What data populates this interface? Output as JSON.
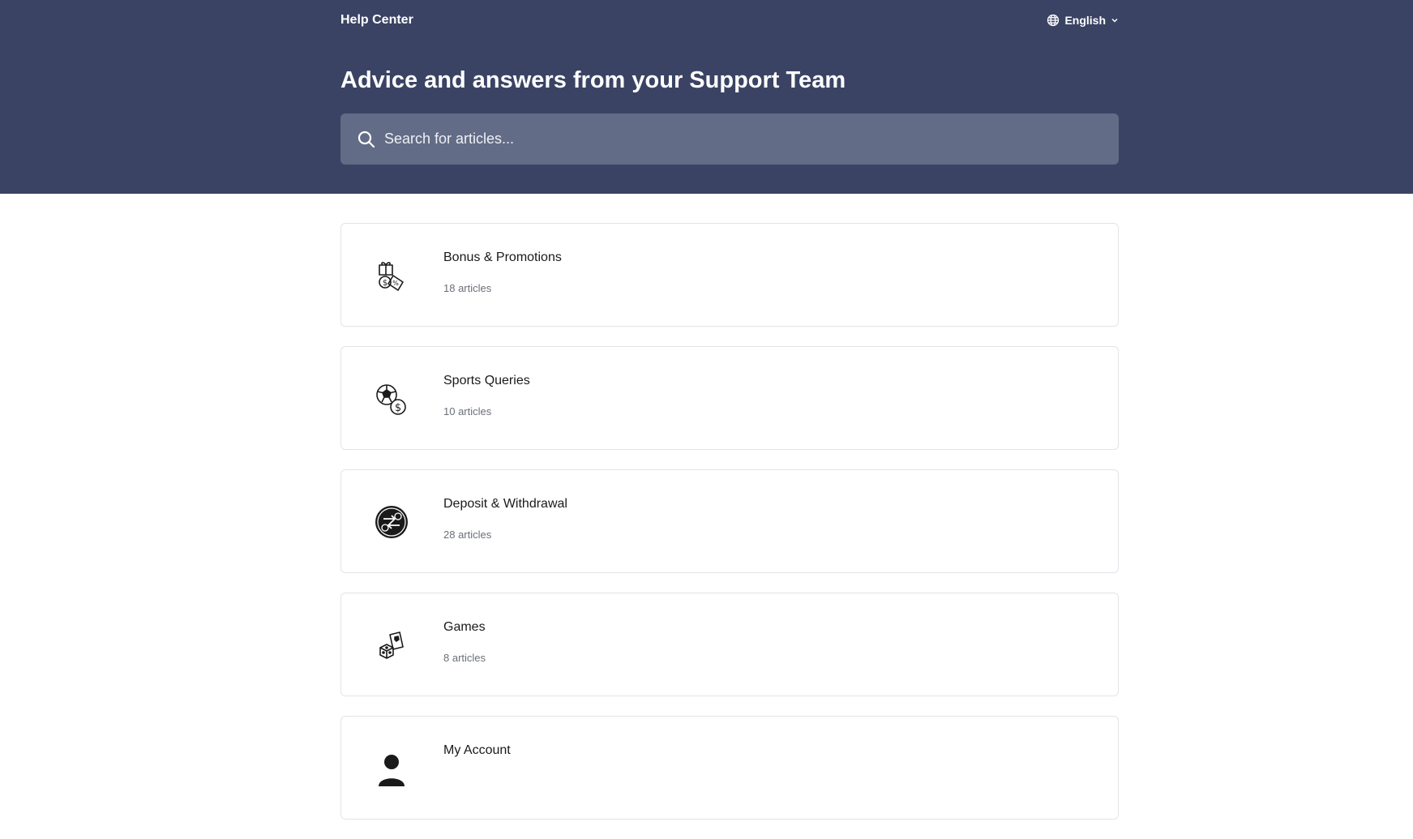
{
  "header": {
    "brand": "Help Center",
    "language": "English",
    "headline": "Advice and answers from your Support Team",
    "search_placeholder": "Search for articles..."
  },
  "colors": {
    "header_bg": "#3a4363",
    "search_bg": "#636c86"
  },
  "collections": [
    {
      "title": "Bonus & Promotions",
      "count": "18 articles",
      "icon": "gift-coupon-icon"
    },
    {
      "title": "Sports Queries",
      "count": "10 articles",
      "icon": "soccer-ball-dollar-icon"
    },
    {
      "title": "Deposit & Withdrawal",
      "count": "28 articles",
      "icon": "money-transfer-icon"
    },
    {
      "title": "Games",
      "count": "8 articles",
      "icon": "dice-cards-icon"
    },
    {
      "title": "My Account",
      "count": "",
      "icon": "user-icon"
    }
  ]
}
